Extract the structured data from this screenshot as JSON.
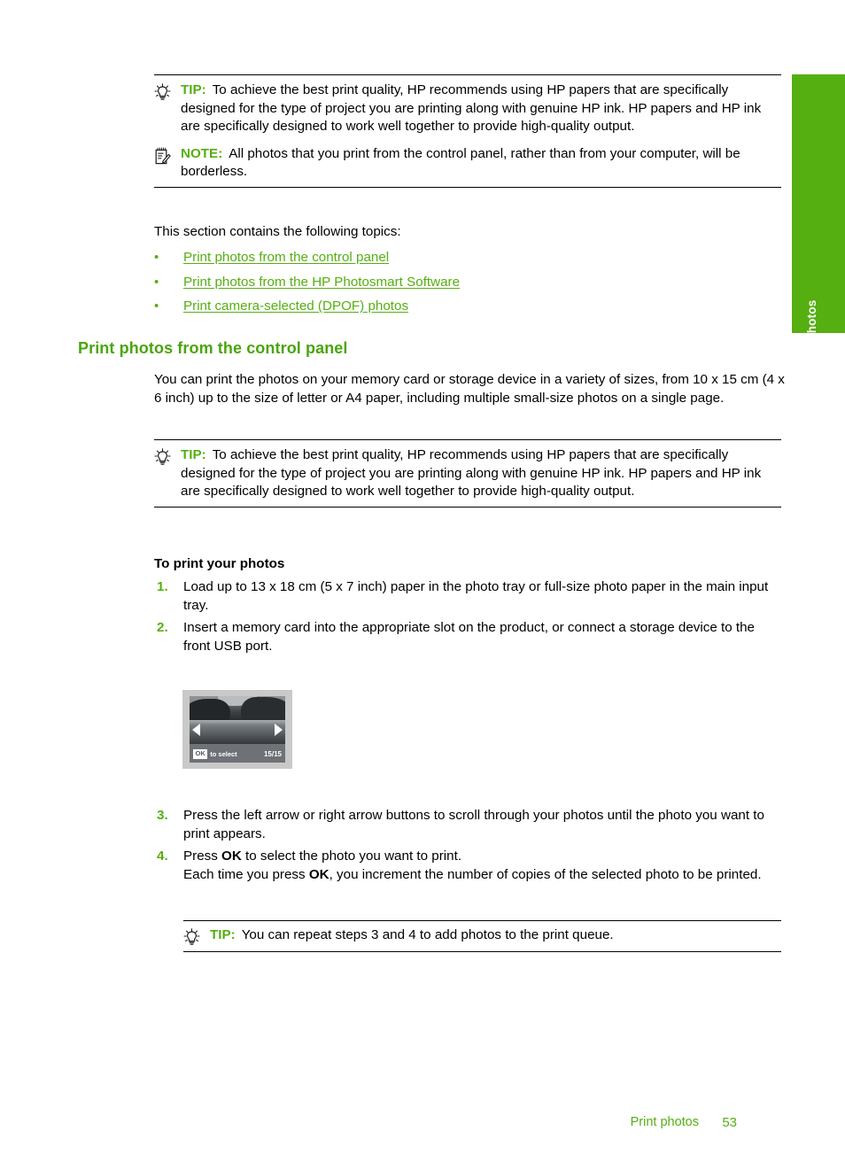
{
  "side_tab": {
    "label": "Photos",
    "color": "#55af10"
  },
  "colors": {
    "green_accent": "#55af10",
    "heading_green": "#4aa50d",
    "text": "#000000"
  },
  "admonitions": {
    "tip_keyword": "TIP:",
    "note_keyword": "NOTE:",
    "tip_icon": "lightbulb-icon",
    "note_icon": "notepad-pencil-icon",
    "tip1_text": "To achieve the best print quality, HP recommends using HP papers that are specifically designed for the type of project you are printing along with genuine HP ink. HP papers and HP ink are specifically designed to work well together to provide high-quality output.",
    "note1_text": "All photos that you print from the control panel, rather than from your computer, will be borderless.",
    "tip2_text": "To achieve the best print quality, HP recommends using HP papers that are specifically designed for the type of project you are printing along with genuine HP ink. HP papers and HP ink are specifically designed to work well together to provide high-quality output.",
    "tip3_text": "You can repeat steps 3 and 4 to add photos to the print queue."
  },
  "intro": {
    "topics_lead": "This section contains the following topics:",
    "bullet_marker": "•",
    "links": [
      "Print photos from the control panel",
      "Print photos from the HP Photosmart Software",
      "Print camera-selected (DPOF) photos"
    ]
  },
  "section": {
    "heading": "Print photos from the control panel",
    "intro_paragraph": "You can print the photos on your memory card or storage device in a variety of sizes, from 10 x 15 cm (4 x 6 inch) up to the size of letter or A4 paper, including multiple small-size photos on a single page.",
    "procedure_heading": "To print your photos",
    "steps": [
      {
        "number": "1.",
        "text": "Load up to 13 x 18 cm (5 x 7 inch) paper in the photo tray or full-size photo paper in the main input tray."
      },
      {
        "number": "2.",
        "text": "Insert a memory card into the appropriate slot on the product, or connect a storage device to the front USB port."
      }
    ],
    "steps_after_figure": [
      {
        "number": "3.",
        "text_a": "Press the left arrow or right arrow buttons to scroll through your photos until the photo you want to print appears.",
        "bold_a": "",
        "text_b": ""
      },
      {
        "number": "4.",
        "line1_pre": "Press ",
        "line1_bold": "OK",
        "line1_post": " to select the photo you want to print.",
        "line2_pre": "Each time you press ",
        "line2_bold": "OK",
        "line2_post": ", you increment the number of copies of the selected photo to be printed."
      }
    ]
  },
  "figure": {
    "name": "control-panel-lcd-display",
    "ok_label": "OK",
    "select_label": "to select",
    "counter": "15/15",
    "left_arrow": "left-arrow-icon",
    "right_arrow": "right-arrow-icon"
  },
  "footer": {
    "section_label": "Print photos",
    "page_number": "53"
  }
}
